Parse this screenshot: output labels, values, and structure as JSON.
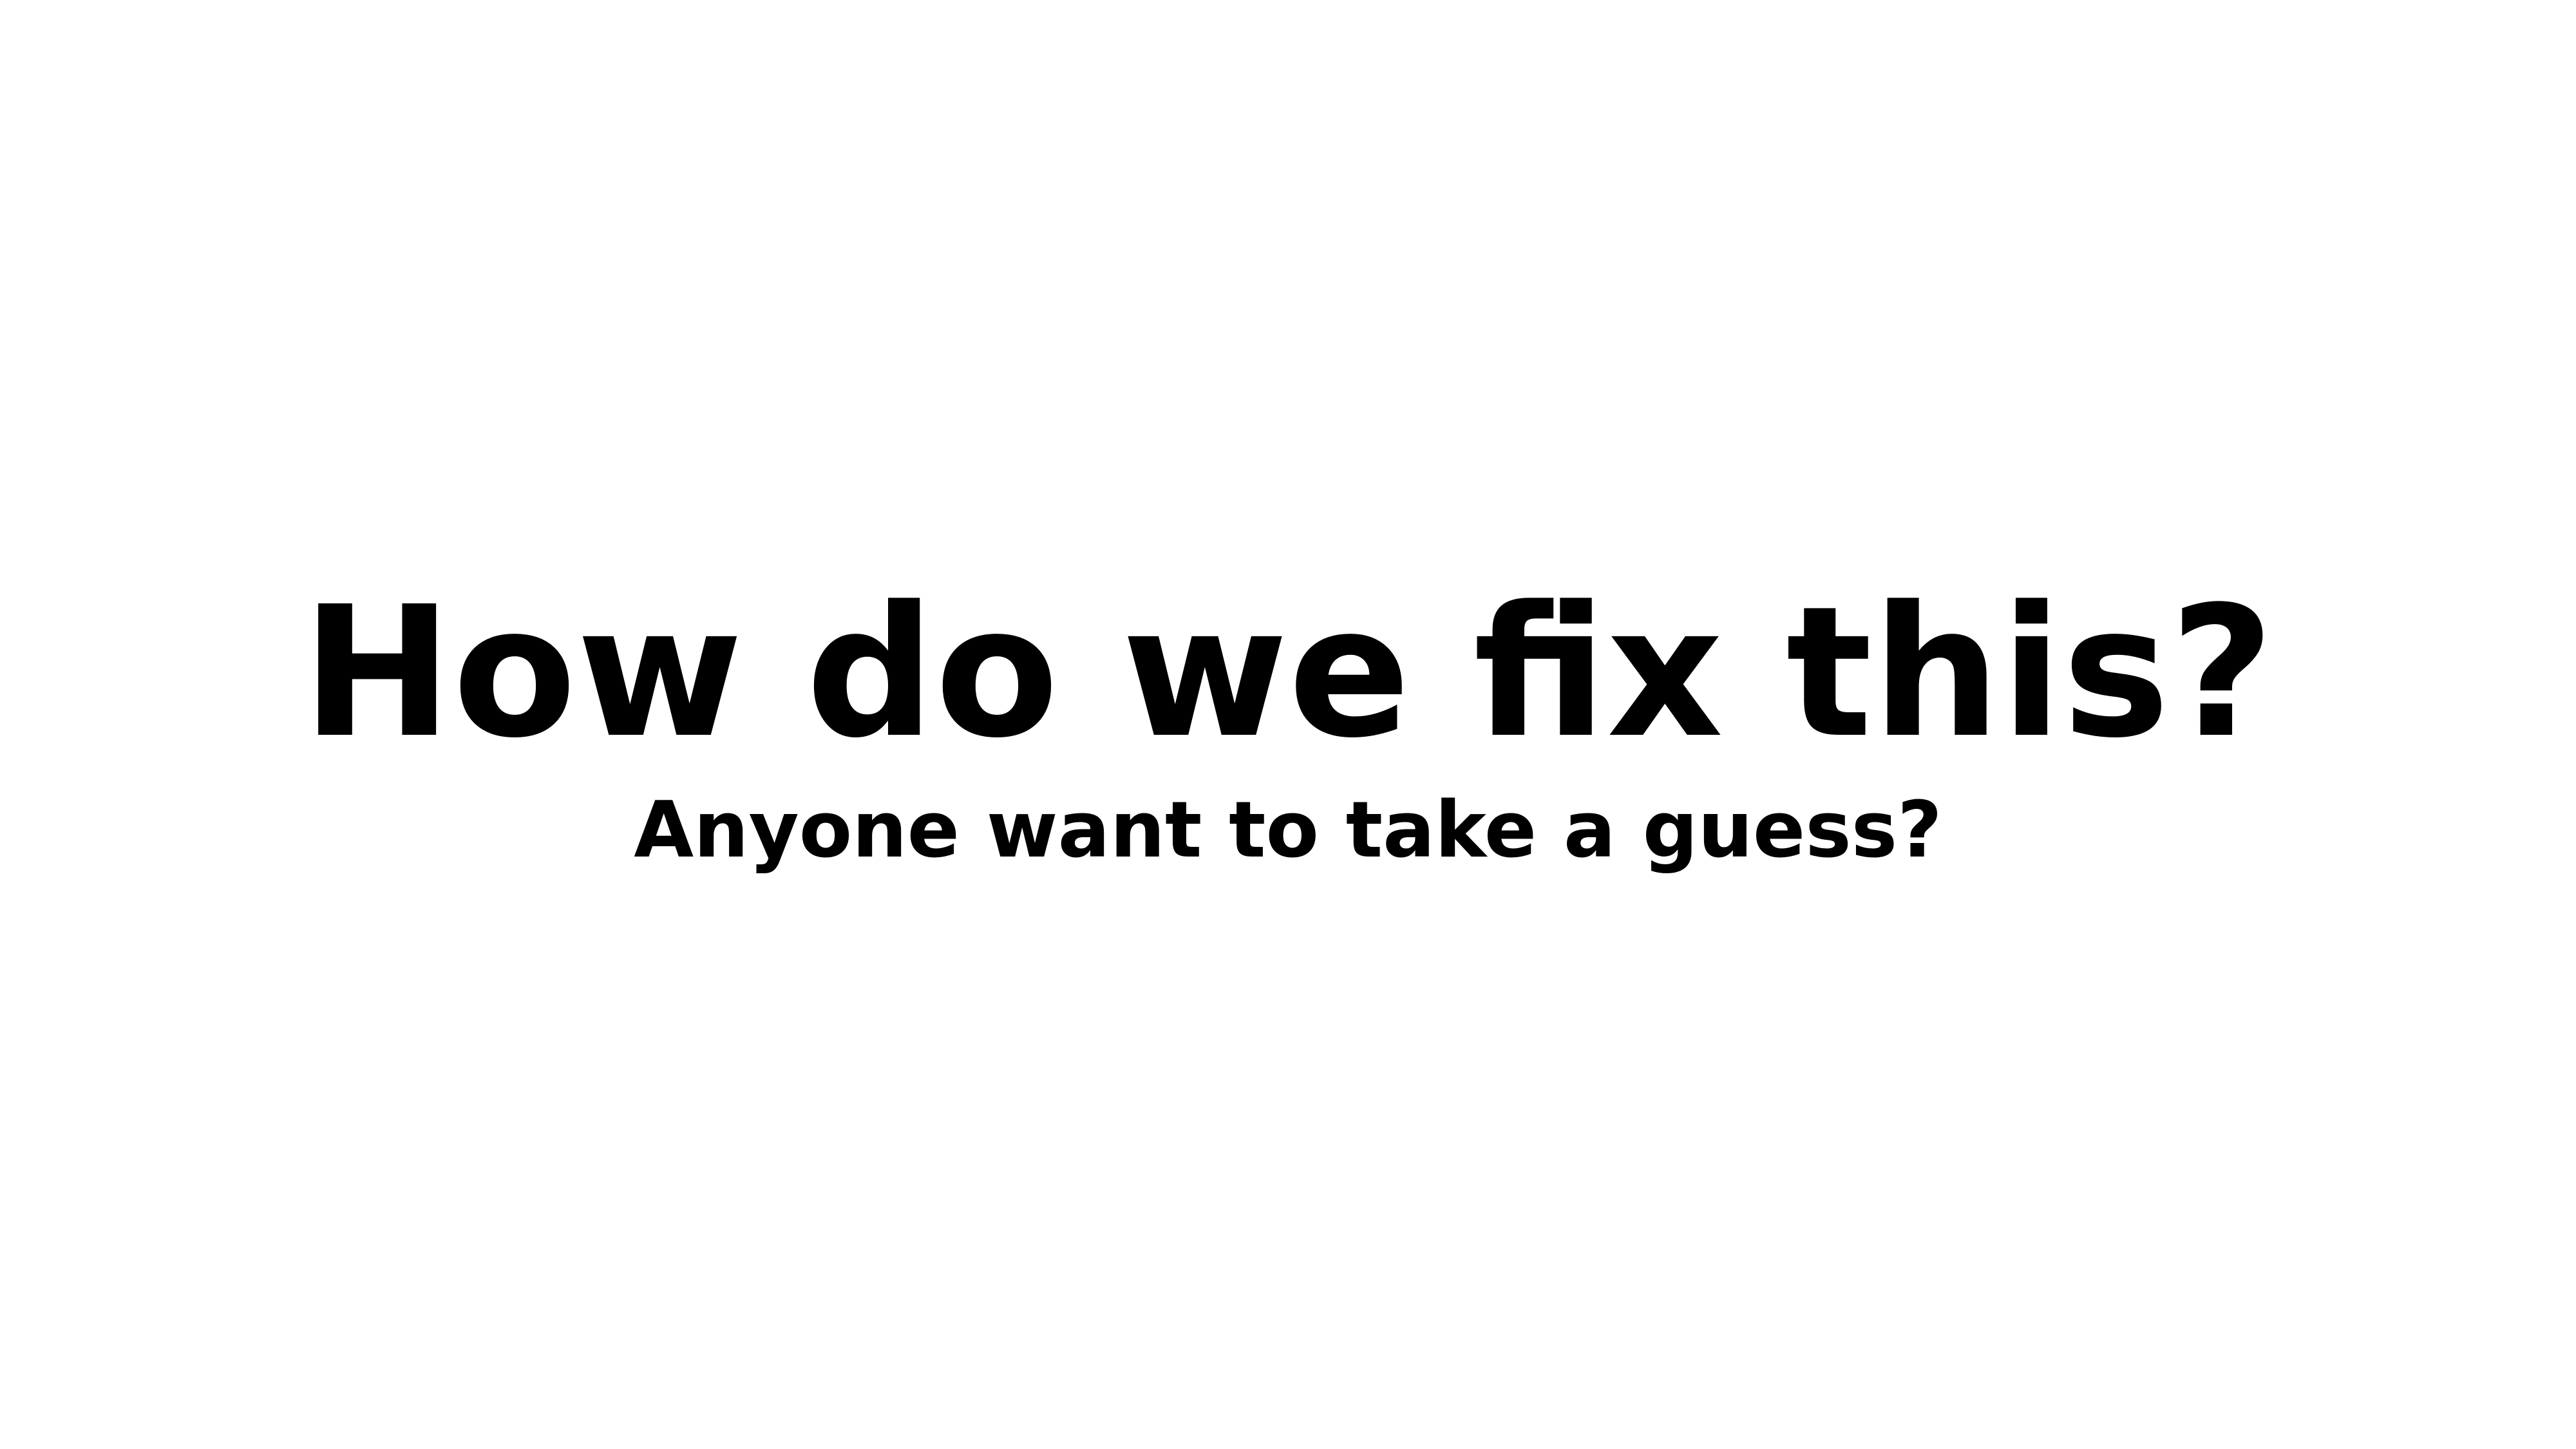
{
  "slide": {
    "title": "How do we fix this?",
    "subtitle": "Anyone want to take a guess?",
    "background_color": "#ffffff",
    "text_color": "#000000"
  }
}
